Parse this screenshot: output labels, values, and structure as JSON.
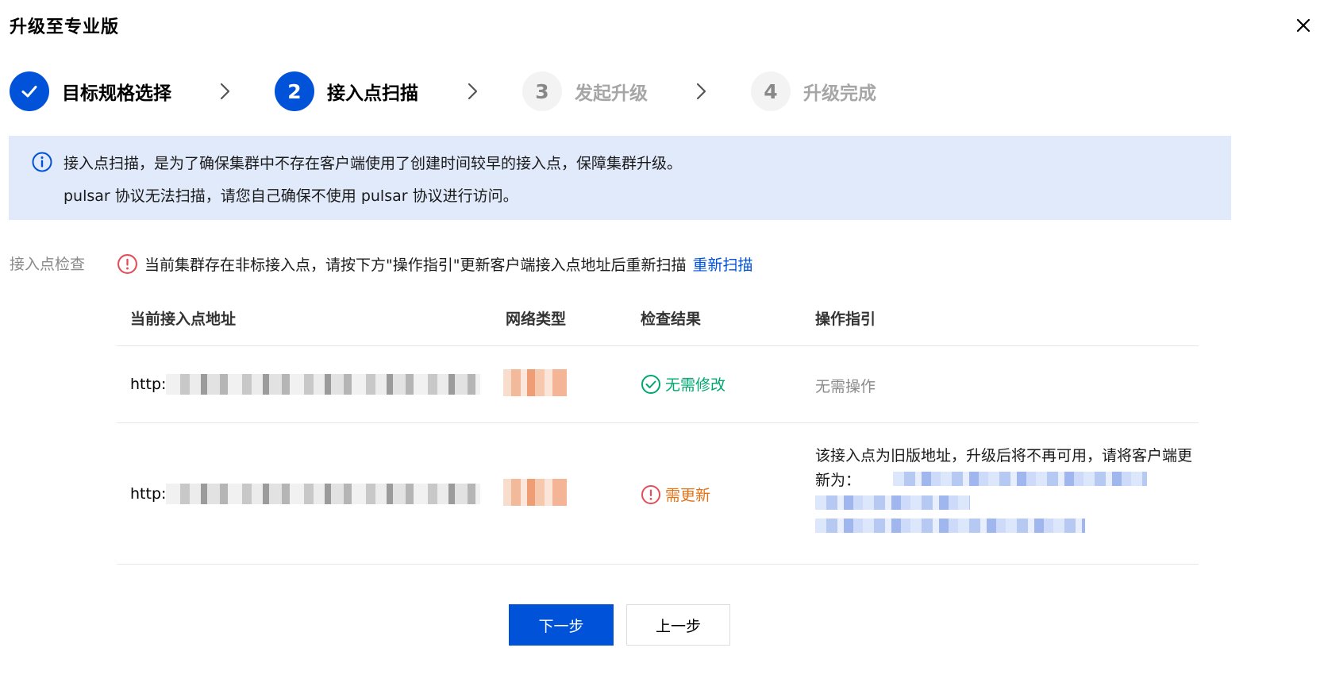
{
  "dialog": {
    "title": "升级至专业版"
  },
  "steps": [
    {
      "number": "",
      "label": "目标规格选择",
      "state": "done"
    },
    {
      "number": "2",
      "label": "接入点扫描",
      "state": "active"
    },
    {
      "number": "3",
      "label": "发起升级",
      "state": "todo"
    },
    {
      "number": "4",
      "label": "升级完成",
      "state": "todo"
    }
  ],
  "banner": {
    "line1": "接入点扫描，是为了确保集群中不存在客户端使用了创建时间较早的接入点，保障集群升级。",
    "line2": "pulsar 协议无法扫描，请您自己确保不使用 pulsar 协议进行访问。"
  },
  "check": {
    "label": "接入点检查",
    "warning": "当前集群存在非标接入点，请按下方\"操作指引\"更新客户端接入点地址后重新扫描",
    "rescan_link": "重新扫描"
  },
  "table": {
    "columns": [
      "当前接入点地址",
      "网络类型",
      "检查结果",
      "操作指引"
    ],
    "rows": [
      {
        "address_prefix": "http:",
        "result": "无需修改",
        "result_type": "ok",
        "guide": "无需操作"
      },
      {
        "address_prefix": "http:",
        "result": "需更新",
        "result_type": "need",
        "guide": "该接入点为旧版地址，升级后将不再可用，请将客户端更新为："
      }
    ]
  },
  "buttons": {
    "next": "下一步",
    "prev": "上一步"
  },
  "colors": {
    "primary": "#0052d9",
    "success": "#00a870",
    "warning": "#e37318",
    "error": "#e34d59",
    "banner_bg": "#e1eafb"
  }
}
